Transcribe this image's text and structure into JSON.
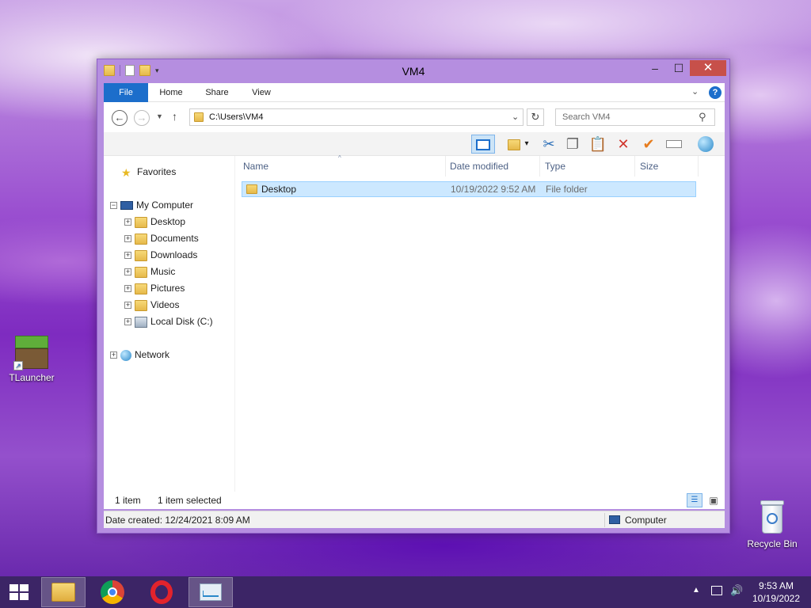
{
  "desktop": {
    "icons": [
      {
        "label": "TLauncher"
      },
      {
        "label": "Recycle Bin"
      }
    ]
  },
  "window": {
    "title": "VM4",
    "controls": {
      "minimize": "–",
      "maximize": "☐",
      "close": "✕"
    },
    "ribbon_tabs": [
      "File",
      "Home",
      "Share",
      "View"
    ],
    "address": "C:\\Users\\VM4",
    "search_placeholder": "Search VM4",
    "help": "?"
  },
  "nav_pane": {
    "favorites": "Favorites",
    "computer": "My Computer",
    "computer_children": [
      "Desktop",
      "Documents",
      "Downloads",
      "Music",
      "Pictures",
      "Videos",
      "Local Disk (C:)"
    ],
    "network": "Network"
  },
  "file_list": {
    "columns": [
      "Name",
      "Date modified",
      "Type",
      "Size"
    ],
    "rows": [
      {
        "name": "Desktop",
        "date": "10/19/2022 9:52 AM",
        "type": "File folder",
        "size": ""
      }
    ]
  },
  "status": {
    "count": "1 item",
    "selected": "1 item selected",
    "details": "Date created: 12/24/2021 8:09 AM",
    "location": "Computer"
  },
  "taskbar": {
    "apps": [
      "file-explorer",
      "chrome",
      "opera",
      "task-manager"
    ],
    "time": "9:53 AM",
    "date": "10/19/2022"
  },
  "colors": {
    "ribbon_file_tab": "#1c6ecb",
    "selection": "#cce8ff",
    "close_button": "#c7504a"
  }
}
